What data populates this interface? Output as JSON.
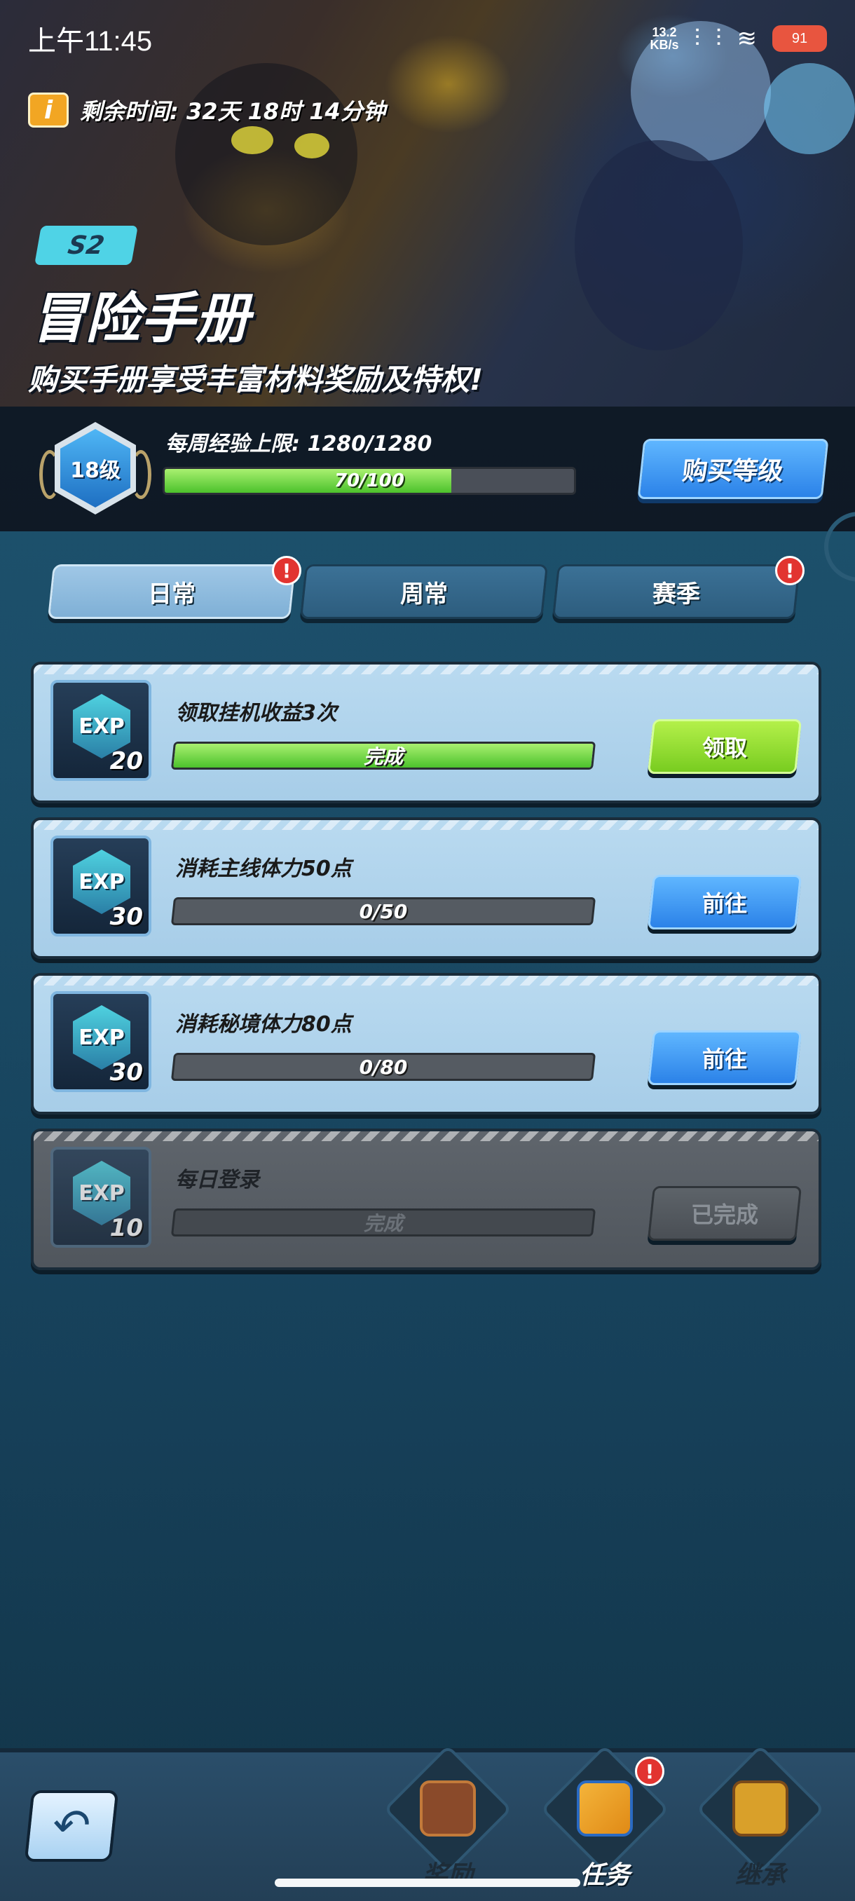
{
  "status_bar": {
    "time": "上午11:45",
    "net_speed_value": "13.2",
    "net_speed_unit": "KB/s",
    "battery": "91"
  },
  "banner": {
    "remaining_time": "剩余时间: 32天 18时 14分钟",
    "season": "S2",
    "title": "冒险手册",
    "subtitle": "购买手册享受丰富材料奖励及特权!"
  },
  "level": {
    "level_label": "18级",
    "weekly_exp_label": "每周经验上限: 1280/1280",
    "exp_text": "70/100",
    "exp_progress": 0.7,
    "buy_button": "购买等级"
  },
  "tabs": [
    {
      "label": "日常",
      "active": true,
      "alert": true
    },
    {
      "label": "周常",
      "active": false,
      "alert": false
    },
    {
      "label": "赛季",
      "active": false,
      "alert": true
    }
  ],
  "tasks": [
    {
      "exp_label": "EXP",
      "exp": "20",
      "title": "领取挂机收益3次",
      "progress_text": "完成",
      "progress": 1.0,
      "button": "领取",
      "state": "claim"
    },
    {
      "exp_label": "EXP",
      "exp": "30",
      "title": "消耗主线体力50点",
      "progress_text": "0/50",
      "progress": 0.0,
      "button": "前往",
      "state": "go"
    },
    {
      "exp_label": "EXP",
      "exp": "30",
      "title": "消耗秘境体力80点",
      "progress_text": "0/80",
      "progress": 0.0,
      "button": "前往",
      "state": "go"
    },
    {
      "exp_label": "EXP",
      "exp": "10",
      "title": "每日登录",
      "progress_text": "完成",
      "progress": 0.0,
      "button": "已完成",
      "state": "done"
    }
  ],
  "bottom_nav": {
    "items": [
      {
        "label": "奖励",
        "icon": "shop-icon",
        "active": false,
        "alert": false
      },
      {
        "label": "任务",
        "icon": "quest-icon",
        "active": true,
        "alert": true
      },
      {
        "label": "继承",
        "icon": "chest-icon",
        "active": false,
        "alert": false
      }
    ]
  }
}
